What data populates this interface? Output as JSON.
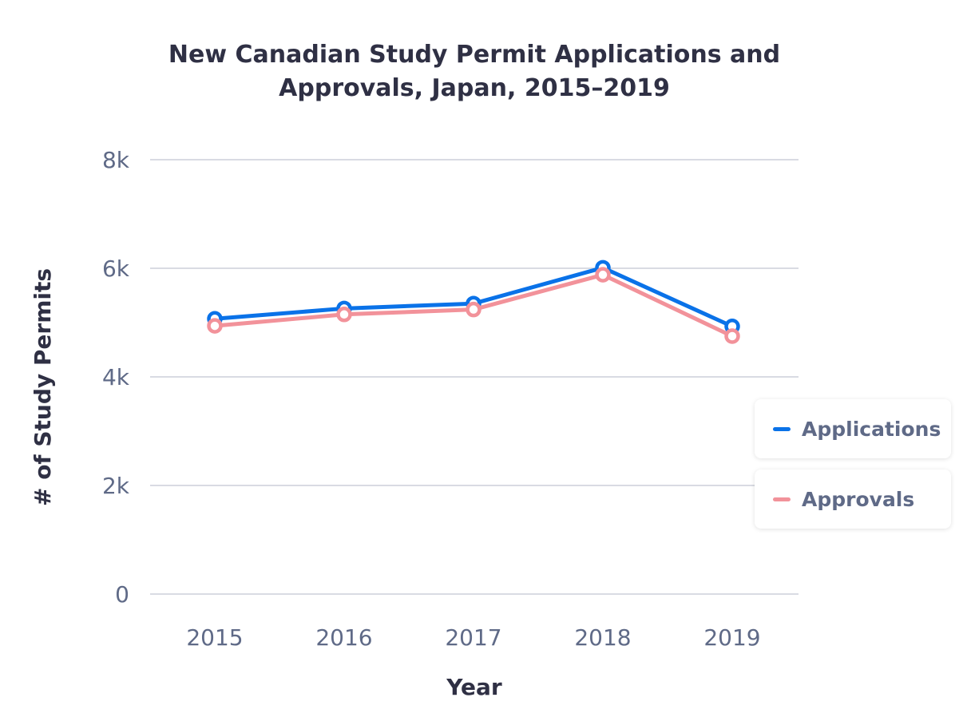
{
  "chart_data": {
    "type": "line",
    "title": "New Canadian Study Permit Applications and Approvals, Japan, 2015–2019",
    "title_lines": [
      "New Canadian Study Permit Applications and",
      "Approvals, Japan, 2015–2019"
    ],
    "xlabel": "Year",
    "ylabel": "# of Study Permits",
    "categories": [
      "2015",
      "2016",
      "2017",
      "2018",
      "2019"
    ],
    "y_ticks": [
      0,
      2000,
      4000,
      6000,
      8000
    ],
    "y_tick_labels": [
      "0",
      "2k",
      "4k",
      "6k",
      "8k"
    ],
    "ylim": [
      0,
      8000
    ],
    "grid": true,
    "legend_position": "right",
    "series": [
      {
        "name": "Applications",
        "color": "#0a72e8",
        "values": [
          5070,
          5260,
          5350,
          6010,
          4930
        ]
      },
      {
        "name": "Approvals",
        "color": "#f2929a",
        "values": [
          4940,
          5150,
          5240,
          5880,
          4750
        ]
      }
    ]
  }
}
